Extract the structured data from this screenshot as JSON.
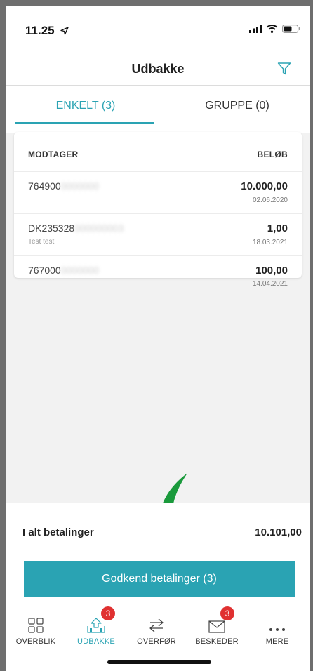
{
  "status_bar": {
    "time": "11.25"
  },
  "header": {
    "title": "Udbakke"
  },
  "tabs": [
    {
      "label": "ENKELT (3)",
      "active": true
    },
    {
      "label": "GRUPPE (0)",
      "active": false
    }
  ],
  "table": {
    "columns": {
      "recipient": "MODTAGER",
      "amount": "BELØB"
    },
    "rows": [
      {
        "recipient_visible": "764900",
        "recipient_blurred": "0000000",
        "note": "",
        "amount": "10.000,00",
        "date": "02.06.2020"
      },
      {
        "recipient_visible": "DK235328",
        "recipient_blurred": "000000003",
        "note": "Test test",
        "amount": "1,00",
        "date": "18.03.2021"
      },
      {
        "recipient_visible": "767000",
        "recipient_blurred": "0000000",
        "note": "",
        "amount": "100,00",
        "date": "14.04.2021"
      }
    ]
  },
  "summary": {
    "label": "I alt betalinger",
    "value": "10.101,00"
  },
  "approve_button": {
    "label": "Godkend betalinger (3)"
  },
  "nav": [
    {
      "label": "OVERBLIK",
      "icon": "grid-icon",
      "badge": ""
    },
    {
      "label": "UDBAKKE",
      "icon": "outbox-icon",
      "badge": "3",
      "active": true
    },
    {
      "label": "OVERFØR",
      "icon": "transfer-icon",
      "badge": ""
    },
    {
      "label": "BESKEDER",
      "icon": "mail-icon",
      "badge": "3"
    },
    {
      "label": "MERE",
      "icon": "more-icon",
      "badge": ""
    }
  ],
  "colors": {
    "accent": "#2aa3b3",
    "badge": "#e03131",
    "annotation_arrow": "#1a9a3c"
  }
}
